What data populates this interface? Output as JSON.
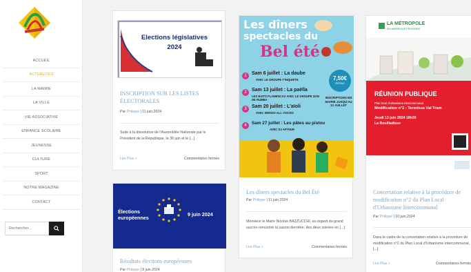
{
  "sidebar": {
    "nav": [
      {
        "label": "ACCUEIL",
        "active": false
      },
      {
        "label": "ACTUALITES",
        "active": true
      },
      {
        "label": "LA MAIRIE",
        "active": false
      },
      {
        "label": "LA VILLE",
        "active": false
      },
      {
        "label": "VIE ASSOCIATIVE",
        "active": false
      },
      {
        "label": "ENFANCE SCOLAIRE",
        "active": false
      },
      {
        "label": "JEUNESSE",
        "active": false
      },
      {
        "label": "CULTURE",
        "active": false
      },
      {
        "label": "SPORT",
        "active": false
      },
      {
        "label": "NOTRE MAGAZINE",
        "active": false
      },
      {
        "label": "CONTACT",
        "active": false
      }
    ],
    "search_placeholder": "Rechercher..."
  },
  "cards": {
    "legislatives": {
      "img_title": "Elections législatives",
      "img_year": "2024",
      "title": "INSCRIPTION SUR LES LISTES ÉLECTORALES",
      "meta_by": "Par",
      "author": "Philippe",
      "date": "| 11 juin,2024",
      "excerpt": "Suite à la dissolution de l'Assemblée Nationale par le Président de la République, le 30 juin et le [...]",
      "more": "Lire Plus >",
      "comments": "Commentaires fermés"
    },
    "europeennes": {
      "img_label": "Élections européennes",
      "img_date": "9 juin 2024",
      "title": "Résultats élections européennes",
      "meta_by": "Par",
      "author": "Philippe",
      "date": "| 9 juin,2024"
    },
    "diners": {
      "poster_line1": "Les dîners",
      "poster_line2": "spectacles du",
      "poster_line3": "Bel été",
      "events": [
        {
          "num": "1",
          "title": "Sam 6 juillet : La daube",
          "sub": "AVEC LE GROUPE T'INQUIETE"
        },
        {
          "num": "2",
          "title": "Sam 13 juillet : La paëlla",
          "sub": "LES NUITS FLAMENCAS AVEC LE GROUPE SON DE RUMBA"
        },
        {
          "num": "3",
          "title": "Sam 20 juillet : L'aïoli",
          "sub": "AVEC SERGIO ALL VOICES"
        },
        {
          "num": "4",
          "title": "Sam 27 juillet : Les pâtes au pistou",
          "sub": "AVEC DJ AFTHUR"
        }
      ],
      "price": "7,50€",
      "price_sub": "REPAS",
      "inscriptions": "INSCRIPTIONS EN MAIRIE JUSQU'AU 12 JUILLET",
      "title": "Les dîners spectacles du Bel Été",
      "meta_by": "Par",
      "author": "Philippe",
      "date": "| 11 juin,2024",
      "excerpt": "Monsieur le Maire Nicolas BAZZUCCHI, au regard du grand succès rencontré la saison dernière, des deux soirées en [...]",
      "more": "Lire Plus >",
      "comments": "Commentaires fermés"
    },
    "metropole": {
      "brand": "LA MÉTROPOLE",
      "brand_sub": "AIX-MARSEILLE-PROVENCE",
      "banner": "RÉUNION PUBLIQUE",
      "banner_lines": [
        "Plan local d'urbanisme intercommunal",
        "Modification n°2 : Terminus Val Tram",
        "Jeudi 13 juin 2024 18h30",
        "La Bouilladisse"
      ],
      "title": "Concertation relative à la procédure de modification n°2 du Plan Local d'Urbanisme Intercommunal",
      "meta_by": "Par",
      "author": "Philippe",
      "date": "| 10 juin,2024",
      "excerpt": "Dans le cadre de la concertation relative à la procédure de modification n°2 du Plan Local d'Urbanisme intercommunal, [...]",
      "more": "Lire Plus >",
      "comments": "Commentaires fermés"
    }
  }
}
